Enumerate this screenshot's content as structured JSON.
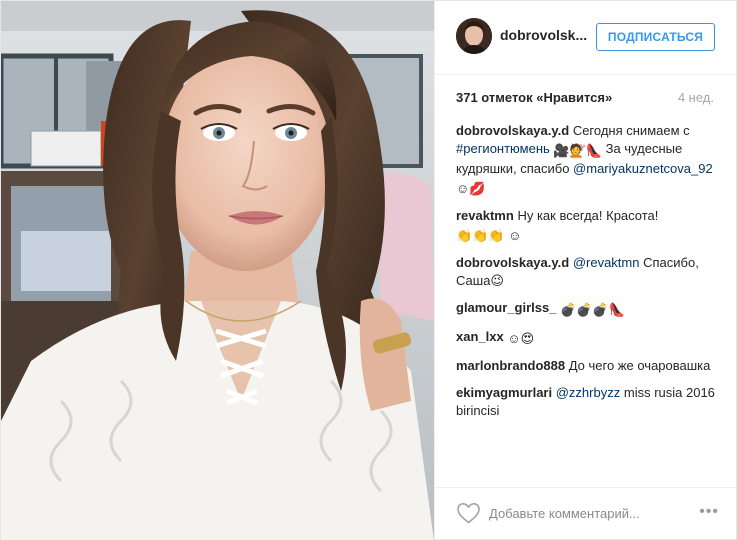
{
  "header": {
    "username": "dobrovolsk...",
    "follow_label": "ПОДПИСАТЬСЯ"
  },
  "stats": {
    "likes": "371 отметок «Нравится»",
    "age": "4 нед."
  },
  "comments": [
    {
      "user": "dobrovolskaya.y.d",
      "text_1": "Сегодня снимаем с",
      "hashtag": "#регионтюмень",
      "emoji": "🎥💇👠",
      "text_2": "За чудесные кудряшки, спасибо",
      "mention": "@mariyakuznetcova_92",
      "emoji_end": "☺💋"
    },
    {
      "user": "revaktmn",
      "text": "Ну как всегда! Красота!",
      "emoji": "👏👏👏 ☺"
    },
    {
      "user": "dobrovolskaya.y.d",
      "mention": "@revaktmn",
      "text": "Спасибо, Саша😉"
    },
    {
      "user": "glamour_girlss_",
      "emoji": "💣💣💣👠"
    },
    {
      "user": "xan_lxx",
      "emoji": "☺😍"
    },
    {
      "user": "marlonbrando888",
      "text": "До чего же очаровашка"
    },
    {
      "user": "ekimyagmurlari",
      "mention": "@zzhrbyzz",
      "text": "miss rusia 2016 birincisi"
    }
  ],
  "footer": {
    "comment_placeholder": "Добавьте комментарий...",
    "more_label": "•••"
  },
  "colors": {
    "accent": "#3897f0",
    "link": "#003569",
    "muted": "#a5a7aa"
  },
  "icons": {
    "like": "heart-icon",
    "more": "more-options-icon"
  }
}
